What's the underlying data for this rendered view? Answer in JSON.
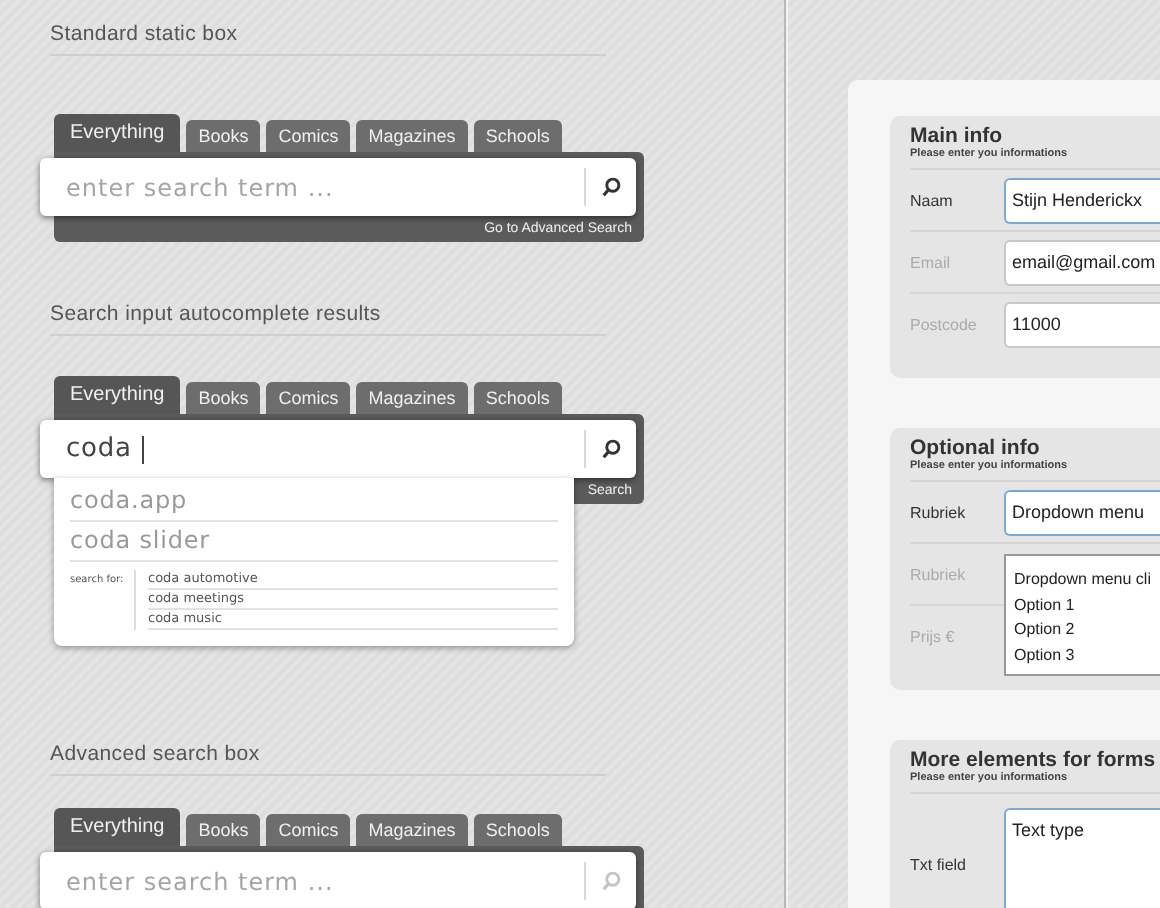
{
  "sections": [
    {
      "kind": "static",
      "heading": "Standard static box",
      "tabs": [
        {
          "label": "Everything",
          "selected": true
        },
        {
          "label": "Books",
          "selected": false
        },
        {
          "label": "Comics",
          "selected": false
        },
        {
          "label": "Magazines",
          "selected": false
        },
        {
          "label": "Schools",
          "selected": false
        }
      ],
      "search": {
        "placeholder": "enter search term ..."
      },
      "footer_link": "Go to Advanced Search"
    },
    {
      "kind": "autocomplete",
      "heading": "Search input autocomplete results",
      "tabs": [
        {
          "label": "Everything",
          "selected": true
        },
        {
          "label": "Books",
          "selected": false
        },
        {
          "label": "Comics",
          "selected": false
        },
        {
          "label": "Magazines",
          "selected": false
        },
        {
          "label": "Schools",
          "selected": false
        }
      ],
      "search": {
        "value": "coda",
        "focused": true
      },
      "footer_link": "Search",
      "suggestions": [
        "coda.app",
        "coda slider"
      ],
      "search_for": {
        "label": "search for:",
        "items": [
          "coda automotive",
          "coda meetings",
          "coda music"
        ]
      }
    },
    {
      "kind": "advanced",
      "heading": "Advanced search box",
      "tabs": [
        {
          "label": "Everything",
          "selected": true
        },
        {
          "label": "Books",
          "selected": false
        },
        {
          "label": "Comics",
          "selected": false
        },
        {
          "label": "Magazines",
          "selected": false
        },
        {
          "label": "Schools",
          "selected": false
        }
      ],
      "search": {
        "placeholder": "enter search term ..."
      }
    }
  ],
  "forms": [
    {
      "title": "Main info",
      "subtitle": "Please enter you informations",
      "fields": [
        {
          "kind": "text",
          "label": "Naam",
          "value": "Stijn Henderickx",
          "focused": true
        },
        {
          "kind": "text",
          "label": "Email",
          "value": "email@gmail.com",
          "focused": false
        },
        {
          "kind": "text",
          "label": "Postcode",
          "value": "11000",
          "focused": false
        }
      ]
    },
    {
      "title": "Optional info",
      "subtitle": "Please enter you informations",
      "fields": [
        {
          "kind": "select",
          "label": "Rubriek",
          "value": "Dropdown menu",
          "focused": true
        },
        {
          "kind": "open_select",
          "label": "Rubriek",
          "value": "Dropdown menu cli",
          "options": [
            "Option 1",
            "Option 2",
            "Option 3"
          ],
          "focused": false
        },
        {
          "kind": "covered",
          "label": "Prijs €",
          "focused": false
        }
      ]
    },
    {
      "title": "More elements for forms",
      "subtitle": "Please enter you informations",
      "fields": [
        {
          "kind": "textarea",
          "label": "Txt field",
          "value": "Text type",
          "focused": true
        }
      ]
    }
  ]
}
